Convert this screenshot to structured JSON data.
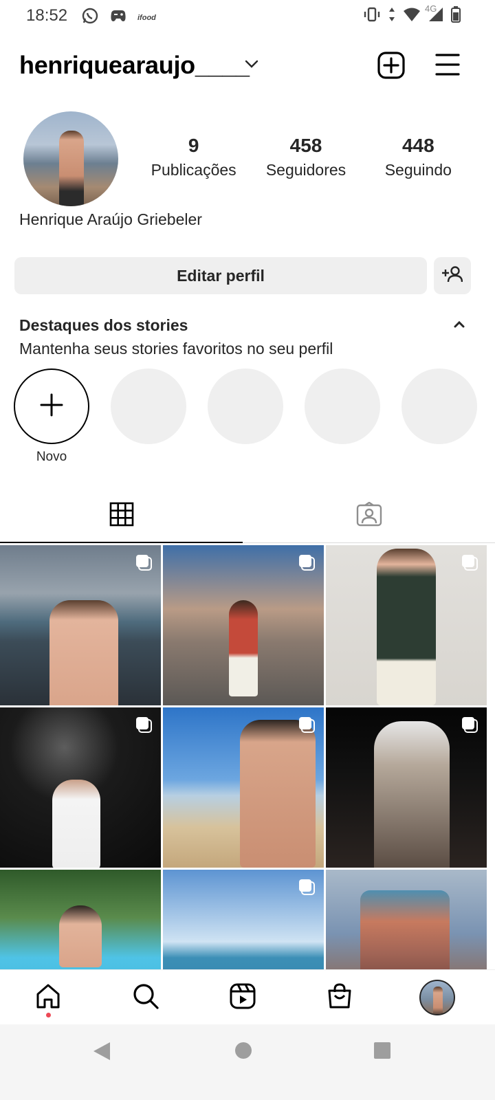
{
  "status_bar": {
    "time": "18:52",
    "left_icons": [
      "whatsapp-icon",
      "game-controller-icon",
      "ifood-icon"
    ],
    "ifood_label": "ifood",
    "network_label": "4G",
    "right_icons": [
      "vibrate-icon",
      "data-arrows-icon",
      "wifi-icon",
      "signal-icon",
      "battery-icon"
    ]
  },
  "header": {
    "username": "henriquearaujo____",
    "icons": [
      "chevron-down-icon",
      "new-post-icon",
      "menu-icon"
    ]
  },
  "profile": {
    "stats": [
      {
        "count": "9",
        "label": "Publicações"
      },
      {
        "count": "458",
        "label": "Seguidores"
      },
      {
        "count": "448",
        "label": "Seguindo"
      }
    ],
    "full_name": "Henrique Araújo Griebeler",
    "edit_button": "Editar perfil"
  },
  "highlights": {
    "title": "Destaques dos stories",
    "subtitle": "Mantenha seus stories favoritos no seu perfil",
    "new_label": "Novo"
  },
  "tabs": [
    "grid-icon",
    "tagged-icon"
  ],
  "grid": {
    "posts": [
      {
        "multi": true
      },
      {
        "multi": true
      },
      {
        "multi": true
      },
      {
        "multi": true
      },
      {
        "multi": true
      },
      {
        "multi": true
      },
      {
        "multi": false
      },
      {
        "multi": true
      },
      {
        "multi": false
      }
    ]
  },
  "bottom_nav": [
    "home-icon",
    "search-icon",
    "reels-icon",
    "shop-icon",
    "profile-avatar"
  ],
  "system_nav": [
    "back-icon",
    "home-circle-icon",
    "recents-icon"
  ],
  "colors": {
    "text": "#262626",
    "button_bg": "#efefef",
    "notification_dot": "#ed4956"
  }
}
